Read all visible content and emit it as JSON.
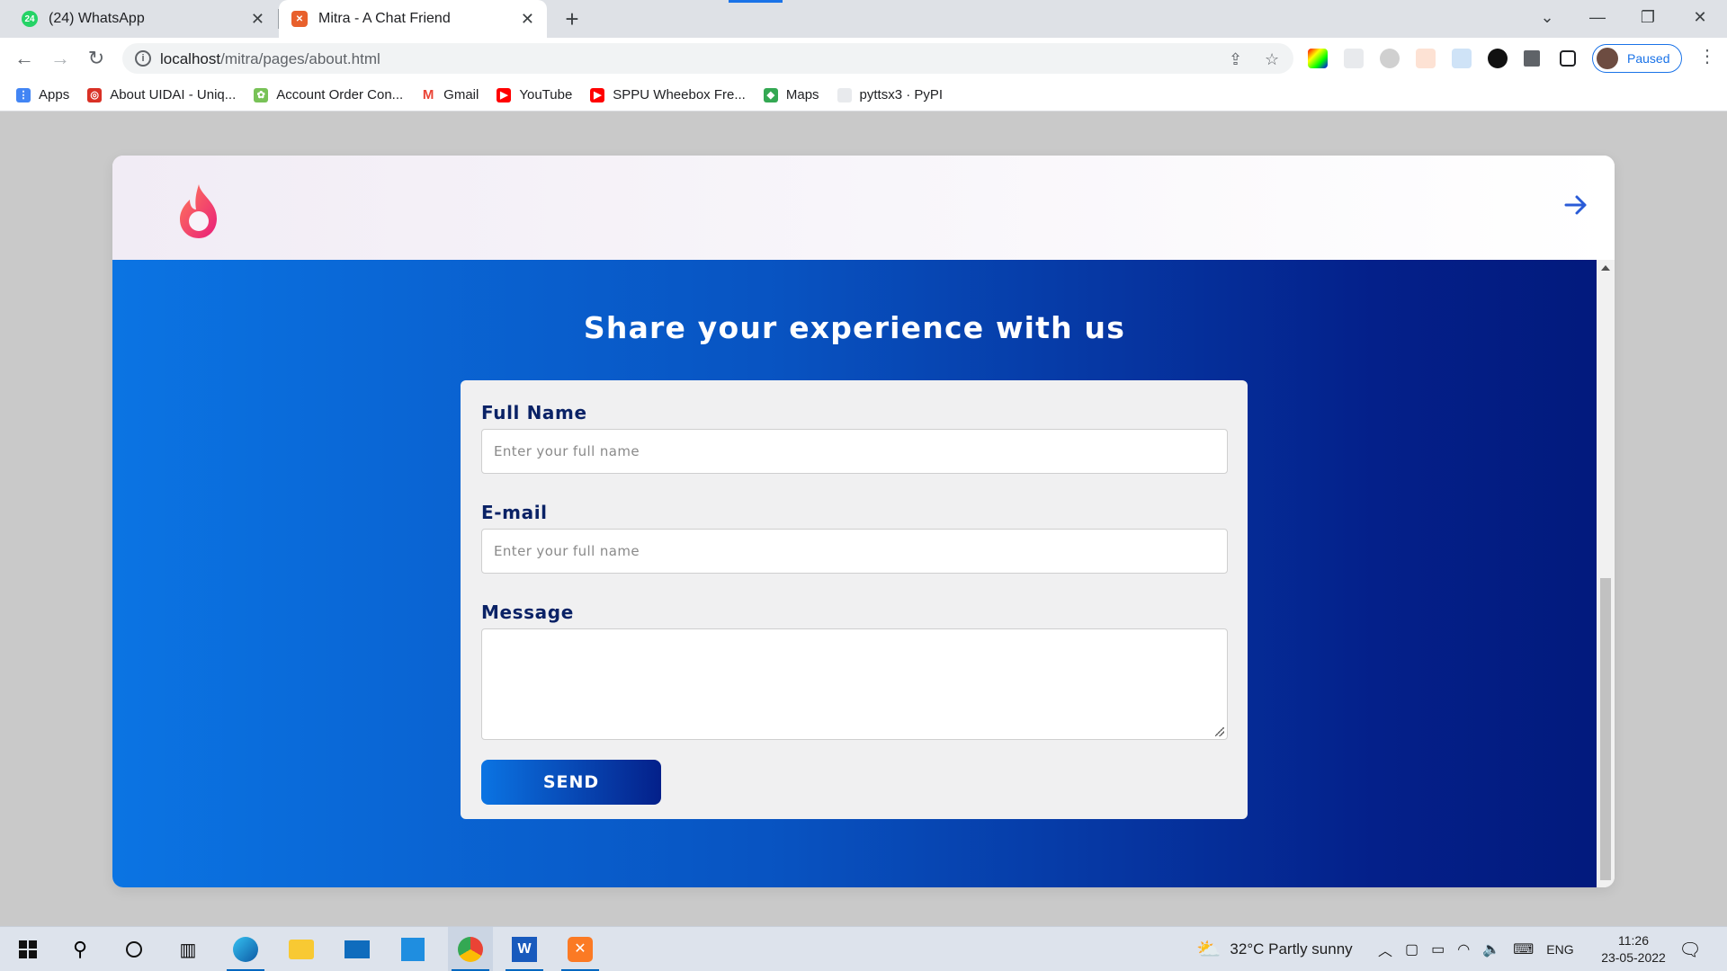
{
  "browser": {
    "tabs": [
      {
        "title": "(24) WhatsApp",
        "badge": "24"
      },
      {
        "title": "Mitra - A Chat Friend"
      }
    ],
    "url_host": "localhost",
    "url_path": "/mitra/pages/about.html",
    "profile_label": "Paused",
    "bookmarks": [
      {
        "label": "Apps",
        "icon": "apps-grid-icon",
        "color": "#4285f4"
      },
      {
        "label": "About UIDAI - Uniq...",
        "icon": "uidai-icon",
        "color": "#d93025"
      },
      {
        "label": "Account Order Con...",
        "icon": "android-icon",
        "color": "#78c257"
      },
      {
        "label": "Gmail",
        "icon": "gmail-icon",
        "color": "#ea4335"
      },
      {
        "label": "YouTube",
        "icon": "youtube-icon",
        "color": "#ff0000"
      },
      {
        "label": "SPPU Wheebox Fre...",
        "icon": "youtube-icon",
        "color": "#ff0000"
      },
      {
        "label": "Maps",
        "icon": "maps-icon",
        "color": "#34a853"
      },
      {
        "label": "pyttsx3 · PyPI",
        "icon": "pypi-icon",
        "color": "#e8eaed"
      }
    ]
  },
  "page": {
    "hero_title": "Share your experience with us",
    "form": {
      "name_label": "Full Name",
      "name_placeholder": "Enter your full name",
      "email_label": "E-mail",
      "email_placeholder": "Enter your full name",
      "message_label": "Message",
      "send_label": "SEND"
    },
    "colors": {
      "gradient_start": "#0b74e3",
      "gradient_end": "#021a7d",
      "label_color": "#0a2266",
      "logo_pink": "#f0477c"
    }
  },
  "taskbar": {
    "weather": "32°C  Partly sunny",
    "language": "ENG",
    "time": "11:26",
    "date": "23-05-2022"
  }
}
